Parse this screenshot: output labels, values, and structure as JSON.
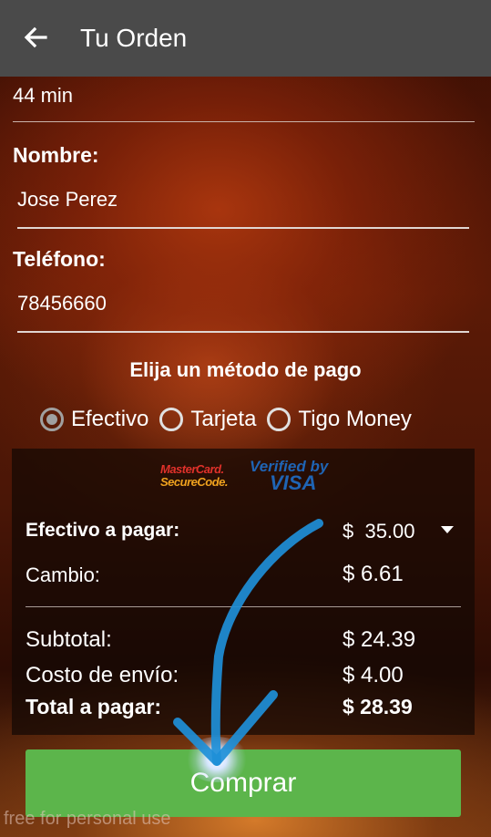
{
  "header": {
    "title": "Tu Orden",
    "back_icon": "arrow-left-icon"
  },
  "eta": "44 min",
  "form": {
    "name_label": "Nombre:",
    "name_value": "Jose Perez",
    "phone_label": "Teléfono:",
    "phone_value": "78456660"
  },
  "payment": {
    "heading": "Elija un método de pago",
    "options": [
      {
        "label": "Efectivo",
        "selected": true
      },
      {
        "label": "Tarjeta",
        "selected": false
      },
      {
        "label": "Tigo Money",
        "selected": false
      }
    ],
    "logos": {
      "mastercard_line1": "MasterCard.",
      "mastercard_line2": "SecureCode.",
      "visa_line1": "Verified by",
      "visa_line2": "VISA"
    }
  },
  "summary": {
    "cash_label": "Efectivo a pagar:",
    "cash_value": "$  35.00",
    "change_label": "Cambio:",
    "change_value": "$ 6.61",
    "subtotal_label": "Subtotal:",
    "subtotal_value": "$ 24.39",
    "shipping_label": "Costo de envío:",
    "shipping_value": "$ 4.00",
    "total_label": "Total a pagar:",
    "total_value": "$ 28.39"
  },
  "buy_button": {
    "label": "Comprar",
    "color": "#5cb54b"
  },
  "watermark": "free for personal use",
  "colors": {
    "appbar": "#4a4a4a",
    "arrow": "#1e8fd8"
  }
}
